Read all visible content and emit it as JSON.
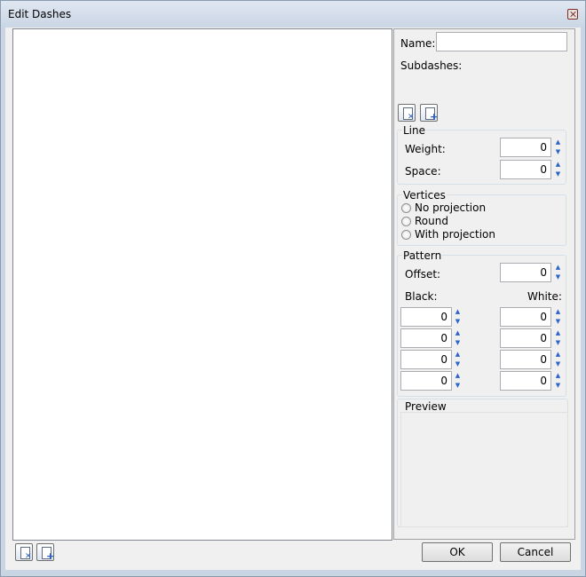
{
  "window": {
    "title": "Edit Dashes"
  },
  "name": {
    "label": "Name:",
    "value": ""
  },
  "subdashes_label": "Subdashes:",
  "line": {
    "title": "Line",
    "weight_label": "Weight:",
    "weight_value": "0",
    "space_label": "Space:",
    "space_value": "0"
  },
  "vertices": {
    "title": "Vertices",
    "options": [
      "No projection",
      "Round",
      "With projection"
    ]
  },
  "pattern": {
    "title": "Pattern",
    "offset_label": "Offset:",
    "offset_value": "0",
    "black_label": "Black:",
    "white_label": "White:",
    "black_values": [
      "0",
      "0",
      "0",
      "0"
    ],
    "white_values": [
      "0",
      "0",
      "0",
      "0"
    ]
  },
  "preview": {
    "title": "Preview"
  },
  "buttons": {
    "ok": "OK",
    "cancel": "Cancel"
  }
}
